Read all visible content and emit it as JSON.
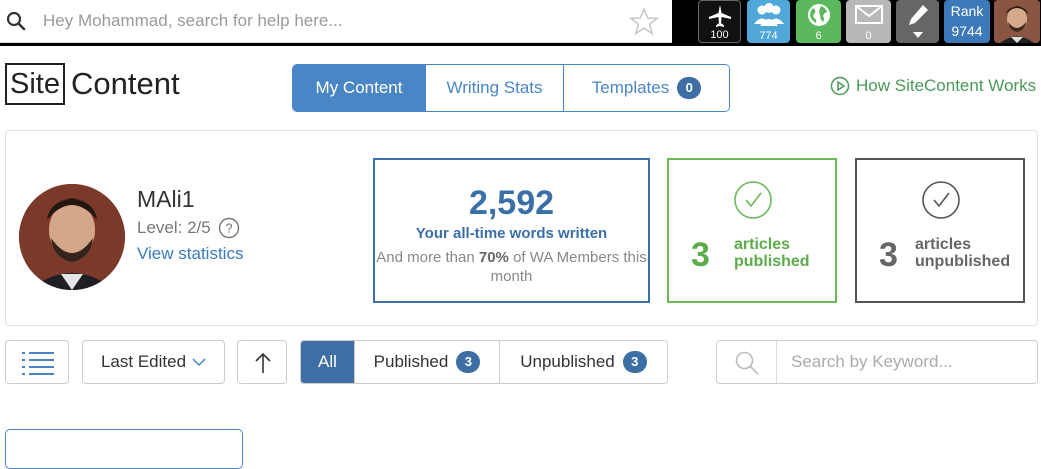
{
  "topbar": {
    "search_placeholder": "Hey Mohammad, search for help here...",
    "icons": [
      "search-icon",
      "star-icon",
      "plane-icon",
      "users-icon",
      "globe-icon",
      "mail-icon",
      "pen-icon"
    ],
    "plane_count": "100",
    "users_count": "774",
    "globe_count": "6",
    "mail_count": "0",
    "rank_label": "Rank",
    "rank_value": "9744"
  },
  "header": {
    "logo_box": "Site",
    "logo_text": "Content",
    "tabs": [
      {
        "label": "My Content",
        "active": true
      },
      {
        "label": "Writing Stats",
        "active": false
      },
      {
        "label": "Templates",
        "active": false,
        "badge": "0"
      }
    ],
    "how_link": "How SiteContent Works"
  },
  "profile": {
    "name": "MAli1",
    "level": "Level: 2/5",
    "help_icon": "?",
    "view_stats": "View statistics"
  },
  "stats": {
    "words_count": "2,592",
    "words_label": "Your all-time words written",
    "words_sub_prefix": "And more than",
    "words_sub_pct": "70%",
    "words_sub_suffix": "of WA Members this month",
    "published_count": "3",
    "published_label_1": "articles",
    "published_label_2": "published",
    "unpublished_count": "3",
    "unpublished_label_1": "articles",
    "unpublished_label_2": "unpublished"
  },
  "filters": {
    "sort_label": "Last Edited",
    "items": [
      {
        "label": "All",
        "active": true
      },
      {
        "label": "Published",
        "badge": "3"
      },
      {
        "label": "Unpublished",
        "badge": "3"
      }
    ],
    "search_placeholder": "Search by Keyword..."
  },
  "colors": {
    "accent_blue": "#4a86c5",
    "dark_blue": "#3a6fa8",
    "green": "#5cac4a",
    "gray": "#666666"
  }
}
